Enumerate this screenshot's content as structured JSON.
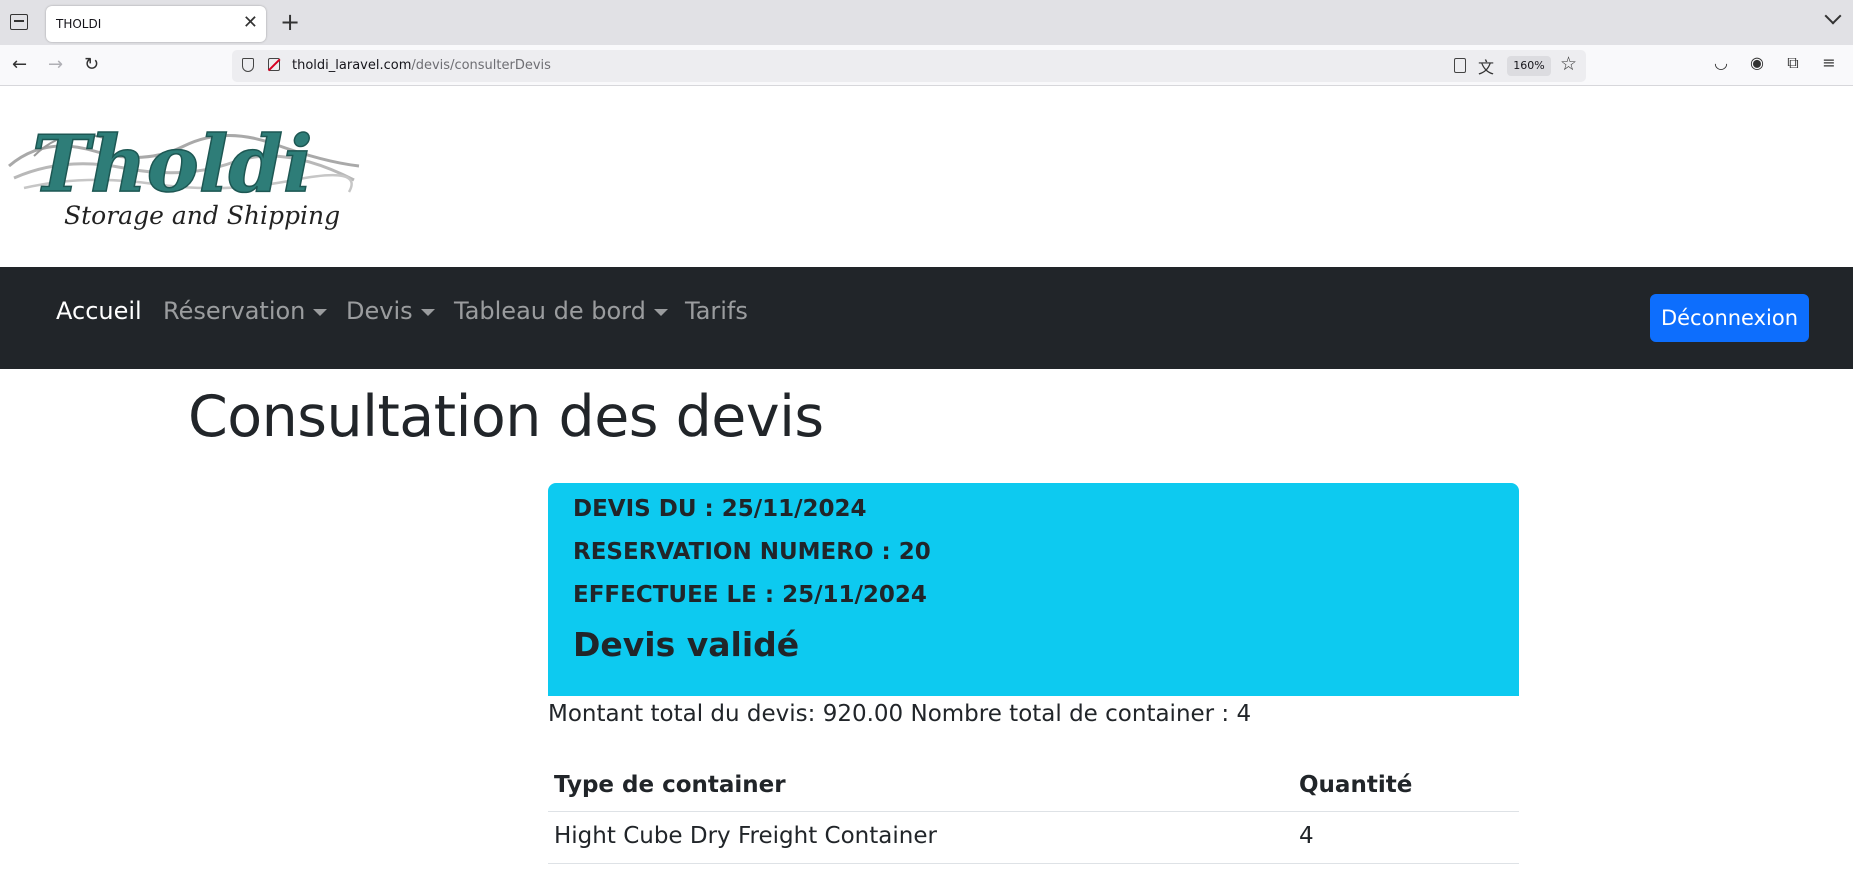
{
  "browser": {
    "tab_title": "THOLDI",
    "url_host": "tholdi_laravel.com",
    "url_path": "/devis/consulterDevis",
    "zoom": "160%"
  },
  "site": {
    "logo_title": "Tholdi",
    "logo_subtitle": "Storage and Shipping",
    "nav": {
      "accueil": "Accueil",
      "reservation": "Réservation",
      "devis": "Devis",
      "tableau": "Tableau de bord",
      "tarifs": "Tarifs",
      "logout": "Déconnexion"
    }
  },
  "page": {
    "title": "Consultation des devis",
    "card": {
      "line1": "DEVIS DU : 25/11/2024",
      "line2": "RESERVATION NUMERO : 20",
      "line3": "EFFECTUEE LE : 25/11/2024",
      "status": "Devis validé"
    },
    "totals": "Montant total du devis: 920.00 Nombre total de container : 4",
    "table": {
      "headers": [
        "Type de container",
        "Quantité"
      ],
      "rows": [
        [
          "Hight Cube Dry Freight Container",
          "4"
        ]
      ]
    }
  },
  "colors": {
    "navbar": "#212529",
    "card": "#0dcaf0",
    "button": "#0d6efd",
    "logo_teal": "#2e7d78"
  }
}
